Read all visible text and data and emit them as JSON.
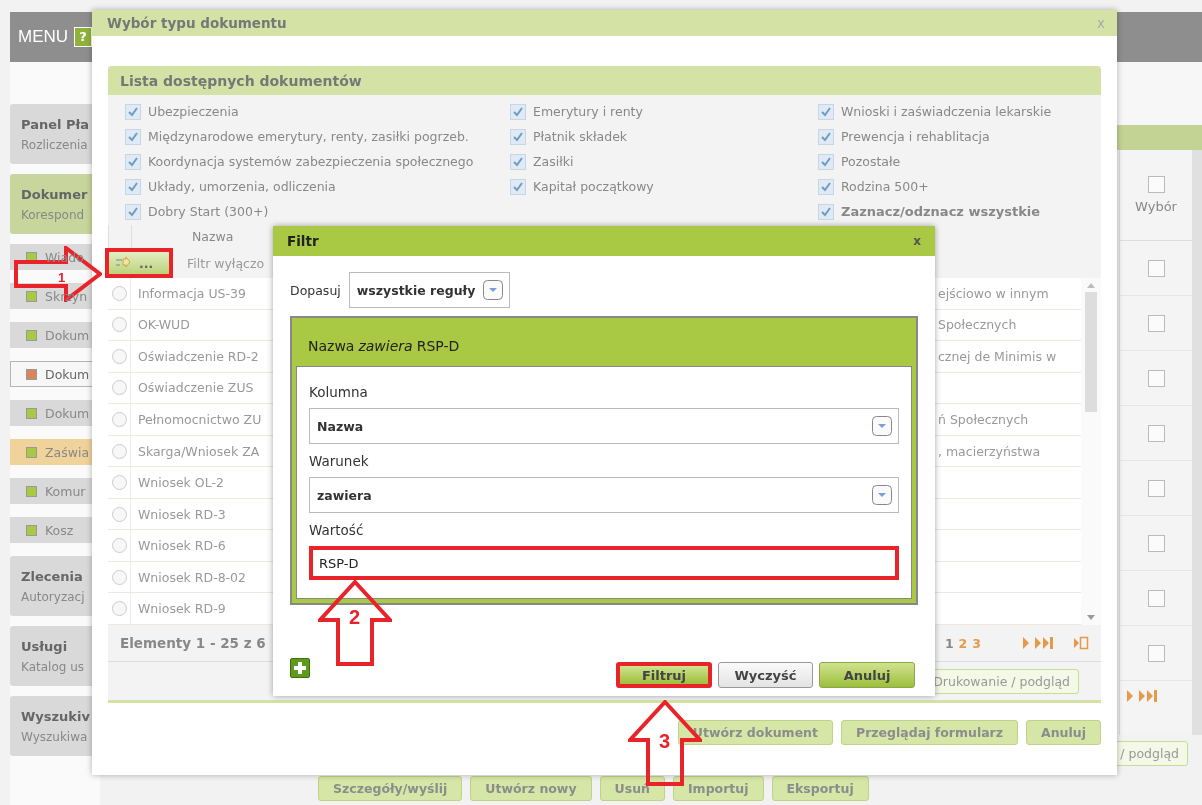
{
  "sidebar": {
    "menu_label": "MENU",
    "help_label": "?",
    "sections": [
      {
        "title": "Panel Pła",
        "subtitle": "Rozliczenia",
        "selected": false
      },
      {
        "title": "Dokumer",
        "subtitle": "Korespond",
        "selected": true,
        "children": [
          {
            "label": "Wiado",
            "color": "#a9c843",
            "selected": false,
            "highlighted": false
          },
          {
            "label": "Skrzyn",
            "color": "#a9c843",
            "selected": false,
            "highlighted": false
          },
          {
            "label": "Dokum",
            "color": "#a9c843",
            "selected": false,
            "highlighted": false
          },
          {
            "label": "Dokum",
            "color": "#d9875a",
            "selected": true,
            "highlighted": false
          },
          {
            "label": "Dokum",
            "color": "#a9c843",
            "selected": false,
            "highlighted": false
          },
          {
            "label": "Zaświa",
            "color": "#a9c843",
            "selected": false,
            "highlighted": true
          },
          {
            "label": "Komur",
            "color": "#a9c843",
            "selected": false,
            "highlighted": false
          },
          {
            "label": "Kosz",
            "color": "#a9c843",
            "selected": false,
            "highlighted": false
          }
        ]
      },
      {
        "title": "Zlecenia",
        "subtitle": "Autoryzacj",
        "selected": false
      },
      {
        "title": "Usługi",
        "subtitle": "Katalog us",
        "selected": false
      },
      {
        "title": "Wyszukiv",
        "subtitle": "Wyszukiwa",
        "selected": false
      }
    ]
  },
  "background": {
    "select_header": {
      "label": "Wybór",
      "checked": false
    },
    "row_checkboxes": [
      {
        "checked": false
      },
      {
        "checked": false
      },
      {
        "checked": false
      },
      {
        "checked": false
      },
      {
        "checked": false
      },
      {
        "checked": false
      },
      {
        "checked": false
      },
      {
        "checked": false
      }
    ],
    "print_button": "/ podgląd",
    "toolbar": [
      "Szczegóły/wyślij",
      "Utwórz nowy",
      "Usuń",
      "Importuj",
      "Eksportuj"
    ]
  },
  "dialog": {
    "title": "Wybór typu dokumentu",
    "close_label": "x",
    "document_list": {
      "title": "Lista dostępnych dokumentów",
      "category_columns": [
        {
          "items": [
            {
              "label": "Ubezpieczenia",
              "checked": true,
              "kind": "category"
            },
            {
              "label": "Międzynarodowe emerytury, renty, zasiłki pogrzeb.",
              "checked": true,
              "kind": "category"
            },
            {
              "label": "Koordynacja systemów zabezpieczenia społecznego",
              "checked": true,
              "kind": "category"
            },
            {
              "label": "Układy, umorzenia, odliczenia",
              "checked": true,
              "kind": "category"
            },
            {
              "label": "Dobry Start (300+)",
              "checked": true,
              "kind": "category"
            }
          ]
        },
        {
          "items": [
            {
              "label": "Emerytury i renty",
              "checked": true,
              "kind": "category"
            },
            {
              "label": "Płatnik składek",
              "checked": true,
              "kind": "category"
            },
            {
              "label": "Zasiłki",
              "checked": true,
              "kind": "category"
            },
            {
              "label": "Kapitał początkowy",
              "checked": true,
              "kind": "category"
            }
          ]
        },
        {
          "items": [
            {
              "label": "Wnioski i zaświadczenia lekarskie",
              "checked": true,
              "kind": "category"
            },
            {
              "label": "Prewencja i rehablitacja",
              "checked": true,
              "kind": "category"
            },
            {
              "label": "Pozostałe",
              "checked": true,
              "kind": "category"
            },
            {
              "label": "Rodzina 500+",
              "checked": true,
              "kind": "category"
            },
            {
              "label": "Zaznacz/odznacz wszystkie",
              "checked": true,
              "kind": "toggle_all"
            }
          ]
        }
      ],
      "columns": [
        "Nazwa"
      ],
      "filter_row": {
        "button_label": "...",
        "highlighted": true,
        "status": "Filtr wyłączo"
      },
      "rows": [
        {
          "name": "Informacja US-39",
          "description": "ejściowo w innym",
          "selected": false
        },
        {
          "name": "OK-WUD",
          "description": "Społecznych",
          "selected": false
        },
        {
          "name": "Oświadczenie RD-2",
          "description": "cznej de Minimis w",
          "selected": false
        },
        {
          "name": "Oświadczenie ZUS",
          "selected": false
        },
        {
          "name": "Pełnomocnictwo ZU",
          "description": "ń Społecznych",
          "selected": false
        },
        {
          "name": "Skarga/Wniosek ZA",
          "description": ", macierzyństwa",
          "selected": false
        },
        {
          "name": "Wniosek OL-2",
          "selected": false
        },
        {
          "name": "Wniosek RD-3",
          "selected": false
        },
        {
          "name": "Wniosek RD-6",
          "selected": false
        },
        {
          "name": "Wniosek RD-8-02",
          "selected": false
        },
        {
          "name": "Wniosek RD-9",
          "selected": false
        }
      ],
      "footer": "Elementy 1 - 25 z 6",
      "pages": [
        {
          "label": "1",
          "selected": true
        },
        {
          "label": "2",
          "selected": false
        },
        {
          "label": "3",
          "selected": false
        }
      ],
      "print_button": "Drukowanie / podgląd"
    },
    "buttons": [
      "Utwórz dokument",
      "Przeglądaj formularz",
      "Anuluj"
    ]
  },
  "filter": {
    "title": "Filtr",
    "close_label": "x",
    "match_label": "Dopasuj",
    "match_value": "wszystkie reguły",
    "rule": {
      "summary": "Nazwa *zawiera* RSP-D",
      "column_label": "Kolumna",
      "column_value": "Nazwa",
      "condition_label": "Warunek",
      "condition_value": "zawiera",
      "value_label": "Wartość",
      "value": "RSP-D",
      "value_highlighted": true
    },
    "buttons": [
      {
        "label": "Filtruj",
        "kind": "primary",
        "highlighted": true
      },
      {
        "label": "Wyczyść",
        "kind": "secondary",
        "highlighted": false
      },
      {
        "label": "Anuluj",
        "kind": "primary",
        "highlighted": false
      }
    ]
  },
  "annotations": [
    {
      "label": "1",
      "kind": "arrow_right"
    },
    {
      "label": "2",
      "kind": "arrow_up"
    },
    {
      "label": "3",
      "kind": "arrow_up"
    }
  ]
}
